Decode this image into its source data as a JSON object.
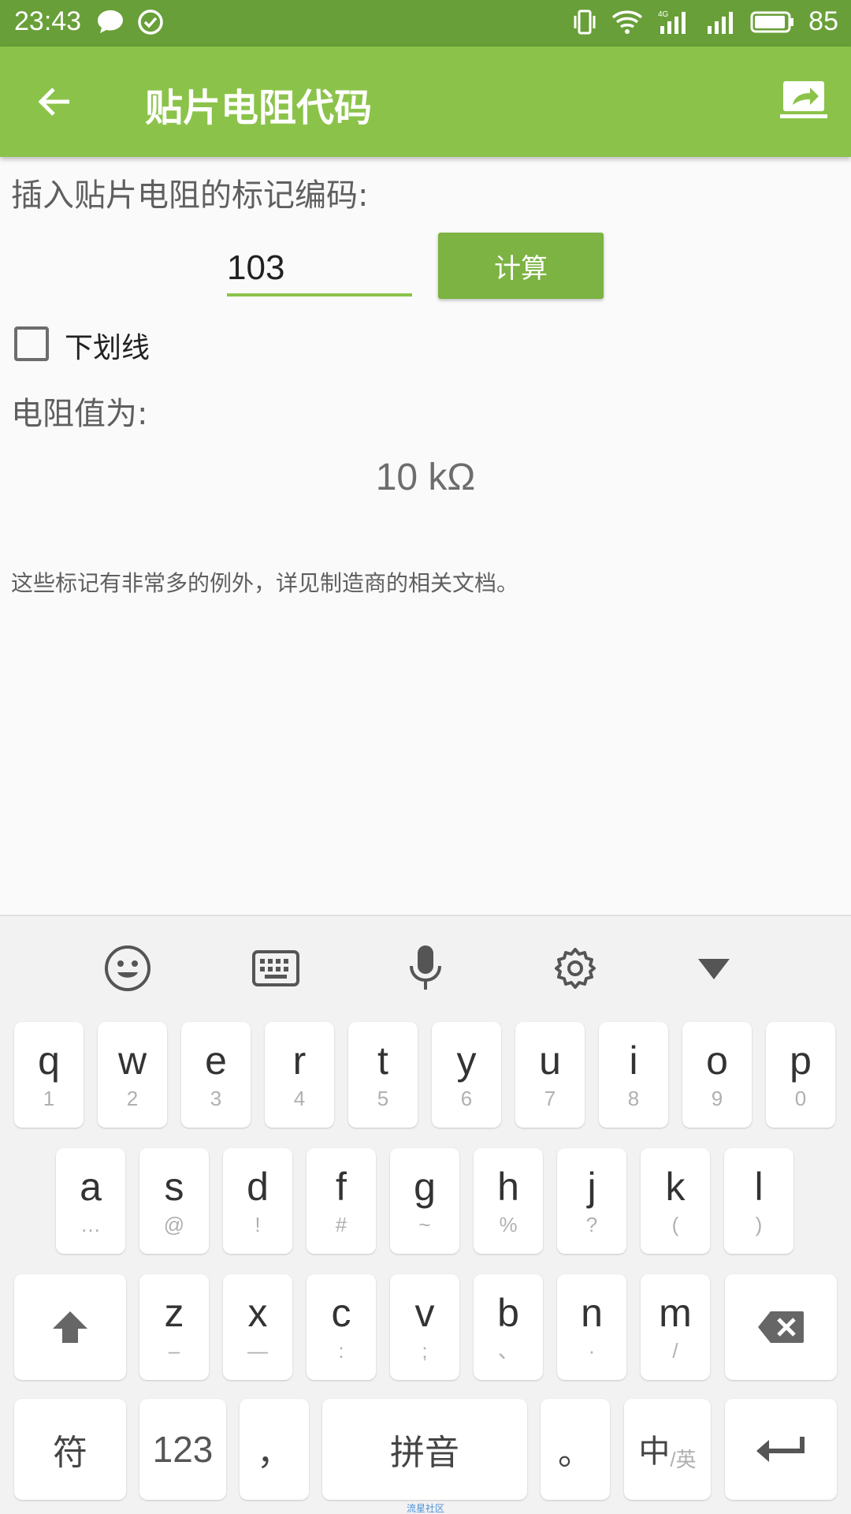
{
  "status_bar": {
    "time": "23:43",
    "battery_percent": "85",
    "network": "4G",
    "icons": [
      "chat-bubble-icon",
      "check-circle-icon",
      "vibrate-icon",
      "wifi-icon",
      "signal-4g-icon",
      "signal-icon",
      "battery-icon"
    ]
  },
  "app_bar": {
    "title": "贴片电阻代码",
    "back_icon": "arrow-back-icon",
    "share_icon": "share-icon",
    "color": "#8bc34a"
  },
  "main": {
    "input_label": "插入贴片电阻的标记编码:",
    "code_value": "103",
    "calc_button": "计算",
    "underline_checkbox_label": "下划线",
    "underline_checked": false,
    "result_label": "电阻值为:",
    "result_value": "10 kΩ",
    "note": "这些标记有非常多的例外，详见制造商的相关文档。"
  },
  "keyboard": {
    "toolbar": [
      "emoji-icon",
      "keyboard-icon",
      "microphone-icon",
      "settings-icon",
      "collapse-icon"
    ],
    "row1": [
      {
        "k": "q",
        "s": "1"
      },
      {
        "k": "w",
        "s": "2"
      },
      {
        "k": "e",
        "s": "3"
      },
      {
        "k": "r",
        "s": "4"
      },
      {
        "k": "t",
        "s": "5"
      },
      {
        "k": "y",
        "s": "6"
      },
      {
        "k": "u",
        "s": "7"
      },
      {
        "k": "i",
        "s": "8"
      },
      {
        "k": "o",
        "s": "9"
      },
      {
        "k": "p",
        "s": "0"
      }
    ],
    "row2": [
      {
        "k": "a",
        "s": "…"
      },
      {
        "k": "s",
        "s": "@"
      },
      {
        "k": "d",
        "s": "!"
      },
      {
        "k": "f",
        "s": "#"
      },
      {
        "k": "g",
        "s": "~"
      },
      {
        "k": "h",
        "s": "%"
      },
      {
        "k": "j",
        "s": "?"
      },
      {
        "k": "k",
        "s": "("
      },
      {
        "k": "l",
        "s": ")"
      }
    ],
    "row3": [
      {
        "k": "z",
        "s": "–"
      },
      {
        "k": "x",
        "s": "—"
      },
      {
        "k": "c",
        "s": ":"
      },
      {
        "k": "v",
        "s": ";"
      },
      {
        "k": "b",
        "s": "、"
      },
      {
        "k": "n",
        "s": "·"
      },
      {
        "k": "m",
        "s": "/"
      }
    ],
    "symbols_key": "符",
    "numbers_key": "123",
    "comma_key": "，",
    "space_key": "拼音",
    "period_key": "。",
    "lang_key_main": "中",
    "lang_key_sub": "/英"
  },
  "watermark": "流星社区"
}
